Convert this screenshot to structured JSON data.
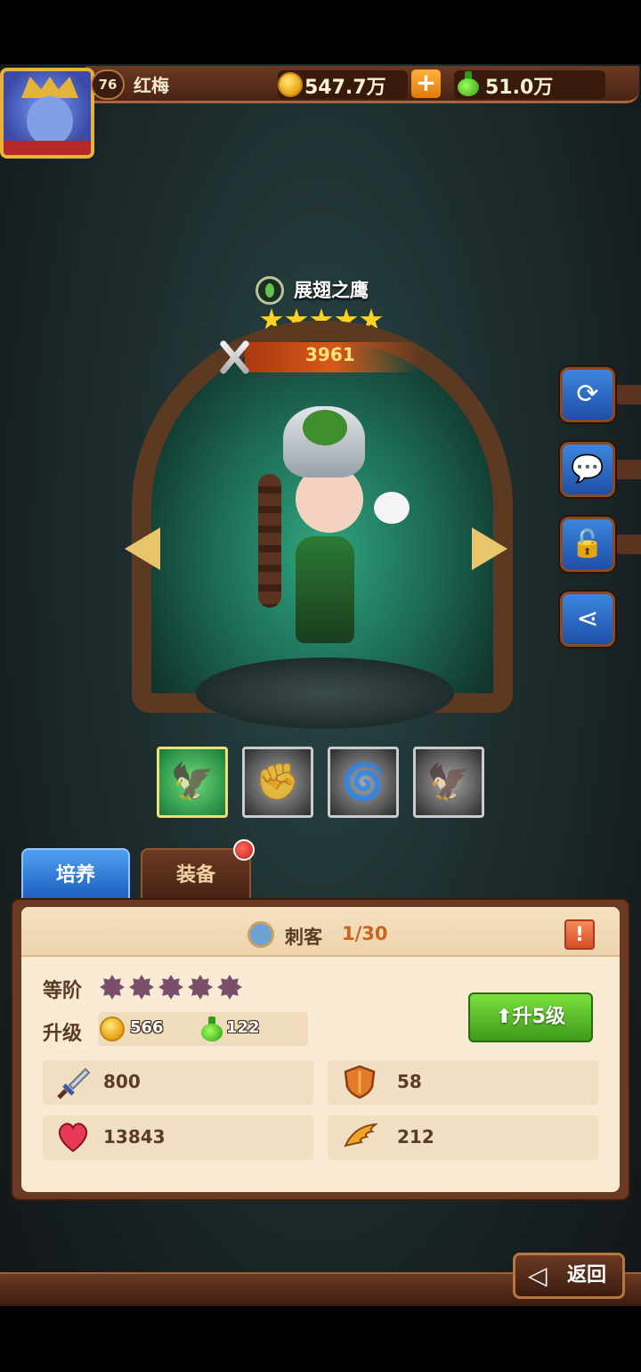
{
  "player": {
    "level": "76",
    "name": "红梅",
    "gold": "547.7万",
    "potion": "51.0万"
  },
  "hero": {
    "name": "展翅之鹰",
    "stars": 5,
    "power": "3961"
  },
  "side_buttons": [
    {
      "id": "refresh",
      "icon": "refresh-icon"
    },
    {
      "id": "chat",
      "icon": "chat-bubble-icon"
    },
    {
      "id": "unlock",
      "icon": "unlocked-padlock-icon"
    },
    {
      "id": "share",
      "icon": "share-icon"
    }
  ],
  "skills": [
    {
      "icon": "green-eagle-skill-icon",
      "active": true
    },
    {
      "icon": "fist-skill-icon",
      "active": false
    },
    {
      "icon": "whirlwind-skill-icon",
      "active": false
    },
    {
      "icon": "eagle-head-skill-icon",
      "active": false
    }
  ],
  "tabs": {
    "train": "培养",
    "equipment": "装备"
  },
  "panel": {
    "class_name": "刺客",
    "class_count": "1/30",
    "info_symbol": "!",
    "grade_label": "等阶",
    "upgrade_label": "升级",
    "grade_gems": 5,
    "cost_gold": "566",
    "cost_potion": "122",
    "upgrade_button": "升5级"
  },
  "stats": {
    "attack": "800",
    "defense": "58",
    "hp": "13843",
    "speed": "212"
  },
  "footer": {
    "back_label": "返回"
  },
  "colors": {
    "accent_blue": "#3d86dd",
    "button_green": "#5cbf2a",
    "wood_brown": "#6b3a23"
  }
}
